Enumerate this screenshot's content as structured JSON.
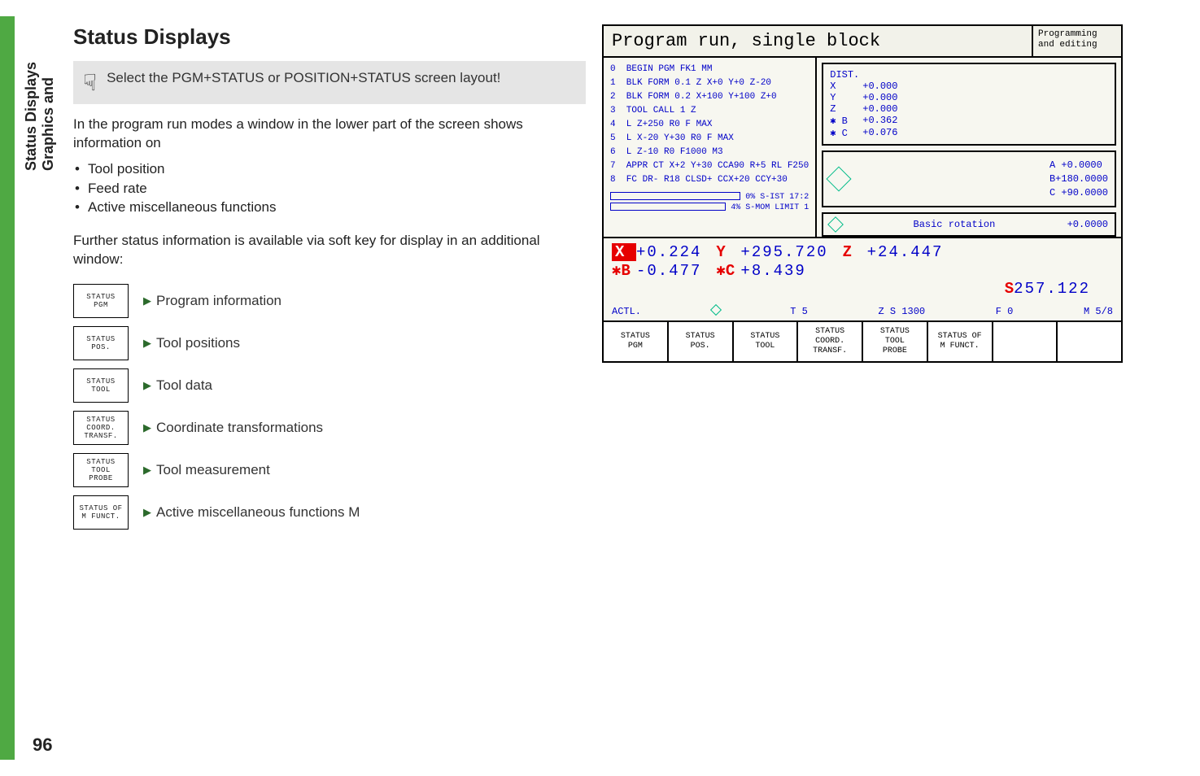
{
  "sidetab": {
    "line1": "Graphics and",
    "line2": "Status Displays"
  },
  "pagenum": "96",
  "heading": "Status Displays",
  "note": "Select the PGM+STATUS or POSITION+STATUS screen layout!",
  "intro": "In the program run modes a window in the lower part of the screen shows information on",
  "bullets": [
    "Tool position",
    "Feed rate",
    "Active miscellaneous functions"
  ],
  "further": "Further status information is available via soft key for display in an additional window:",
  "softkeys": [
    {
      "key": [
        "STATUS",
        "PGM"
      ],
      "desc": "Program information"
    },
    {
      "key": [
        "STATUS",
        "POS."
      ],
      "desc": "Tool positions"
    },
    {
      "key": [
        "STATUS",
        "TOOL"
      ],
      "desc": "Tool data"
    },
    {
      "key": [
        "STATUS",
        "COORD.",
        "TRANSF."
      ],
      "desc": "Coordinate transformations"
    },
    {
      "key": [
        "STATUS",
        "TOOL",
        "PROBE"
      ],
      "desc": "Tool measurement"
    },
    {
      "key": [
        "STATUS OF",
        "M FUNCT."
      ],
      "desc": "Active miscellaneous functions M"
    }
  ],
  "screenshot": {
    "title": "Program run, single block",
    "mode": "Programming and editing",
    "program": [
      "0  BEGIN PGM FK1 MM",
      "1  BLK FORM 0.1 Z X+0 Y+0 Z-20",
      "2  BLK FORM 0.2 X+100 Y+100 Z+0",
      "3  TOOL CALL 1 Z",
      "4  L Z+250 R0 F MAX",
      "5  L X-20 Y+30 R0 F MAX",
      "6  L Z-10 R0 F1000 M3",
      "7  APPR CT X+2 Y+30 CCA90 R+5 RL F250",
      "8  FC DR- R18 CLSD+ CCX+20 CCY+30"
    ],
    "bars": {
      "top": "0% S-IST 17:2",
      "bottom": "4% S-MOM LIMIT 1"
    },
    "dist": {
      "label": "DIST.",
      "rows": [
        {
          "ax": "X",
          "v": "+0.000"
        },
        {
          "ax": "Y",
          "v": "+0.000"
        },
        {
          "ax": "Z",
          "v": "+0.000"
        },
        {
          "ax": "✱ B",
          "v": "+0.362"
        },
        {
          "ax": "✱ C",
          "v": "+0.076"
        }
      ]
    },
    "angles": [
      "A  +0.0000",
      "B+180.0000",
      "C +90.0000"
    ],
    "rotation": {
      "label": "Basic rotation",
      "val": "+0.0000"
    },
    "coords": {
      "r1": {
        "x_ax": "X",
        "x": "+0.224",
        "y_ax": "Y",
        "y": "+295.720",
        "z_ax": "Z",
        "z": "+24.447"
      },
      "r2": {
        "b_ax": "✱B",
        "b": "-0.477",
        "c_ax": "✱C",
        "c": "+8.439"
      },
      "s_ax": "S",
      "s": "257.122"
    },
    "statusline": {
      "actl": "ACTL.",
      "t": "T 5",
      "zs": "Z S 1300",
      "f": "F 0",
      "m": "M 5/8"
    },
    "softbar": [
      [
        "STATUS",
        "PGM"
      ],
      [
        "STATUS",
        "POS."
      ],
      [
        "STATUS",
        "TOOL"
      ],
      [
        "STATUS",
        "COORD.",
        "TRANSF."
      ],
      [
        "STATUS",
        "TOOL",
        "PROBE"
      ],
      [
        "STATUS OF",
        "M FUNCT."
      ],
      [
        ""
      ],
      [
        ""
      ]
    ]
  }
}
